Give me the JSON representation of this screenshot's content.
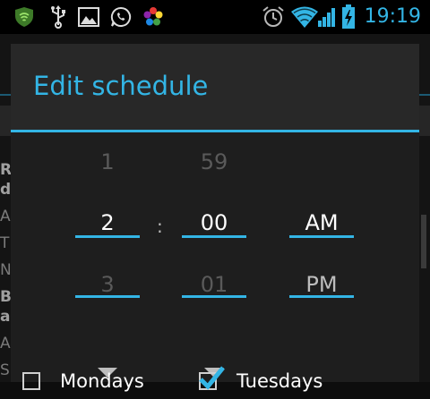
{
  "status_bar": {
    "time": "19:19",
    "icons": [
      "shield-icon",
      "usb-icon",
      "gallery-icon",
      "whatsapp-icon",
      "flower-app-icon",
      "alarm-icon",
      "wifi-icon",
      "signal-icon",
      "battery-charging-icon"
    ]
  },
  "colors": {
    "accent": "#33b5e5",
    "dialog_bg": "#1e1e1e",
    "title_bg": "#282828"
  },
  "background_app": {
    "letters": [
      "R",
      "d",
      "A",
      "T",
      "N",
      "B",
      "a",
      "A",
      "S"
    ]
  },
  "dialog": {
    "title": "Edit schedule",
    "time_picker": {
      "separator": ":",
      "hour": {
        "above": "1",
        "current": "2",
        "below": "3"
      },
      "minute": {
        "above": "59",
        "current": "00",
        "below": "01"
      },
      "ampm": {
        "current": "AM",
        "below": "PM"
      }
    },
    "days": [
      {
        "label": "Mondays",
        "checked": false
      },
      {
        "label": "Tuesdays",
        "checked": true
      }
    ]
  }
}
